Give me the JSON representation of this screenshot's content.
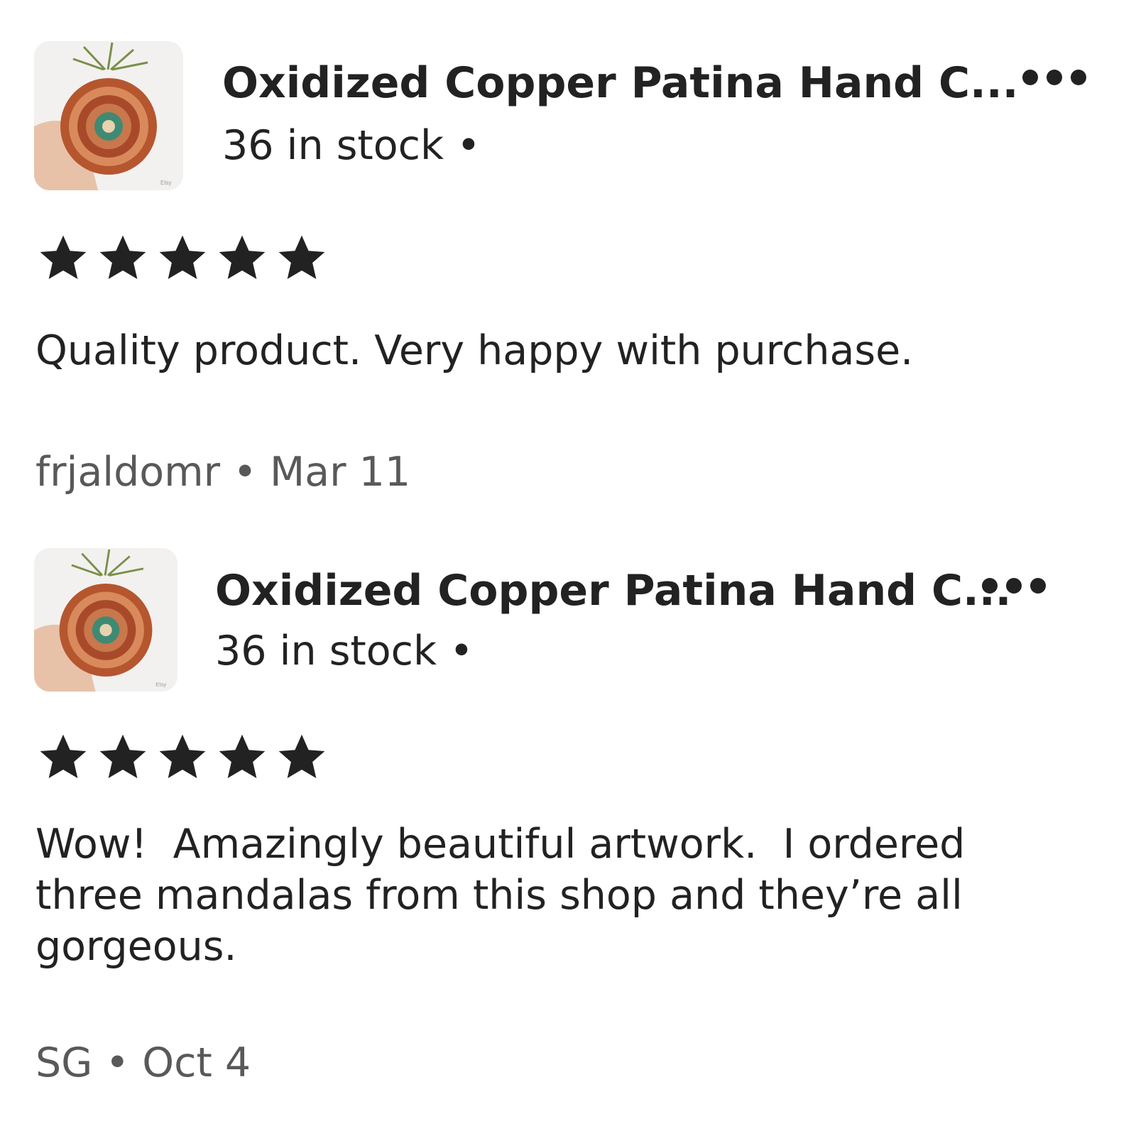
{
  "reviews": [
    {
      "product_title": "Oxidized Copper Patina Hand C...",
      "stock": "36 in stock •",
      "rating": 5,
      "rating_max": 5,
      "text": "Quality product. Very happy with purchase.",
      "author": "frjaldomr",
      "separator": "•",
      "date": "Mar 11",
      "thumbnail_icon": "mandala-product-photo"
    },
    {
      "product_title": "Oxidized Copper Patina Hand C...",
      "stock": "36 in stock •",
      "rating": 5,
      "rating_max": 5,
      "text": "Wow!  Amazingly beautiful artwork.  I ordered three mandalas from this shop and they’re all gorgeous.",
      "author": "SG",
      "separator": "•",
      "date": "Oct 4",
      "thumbnail_icon": "mandala-product-photo"
    }
  ],
  "colors": {
    "text": "#222222",
    "meta_text": "#595959",
    "star": "#222222",
    "mandala_copper": "#b5562f",
    "mandala_patina": "#3f8a73"
  }
}
